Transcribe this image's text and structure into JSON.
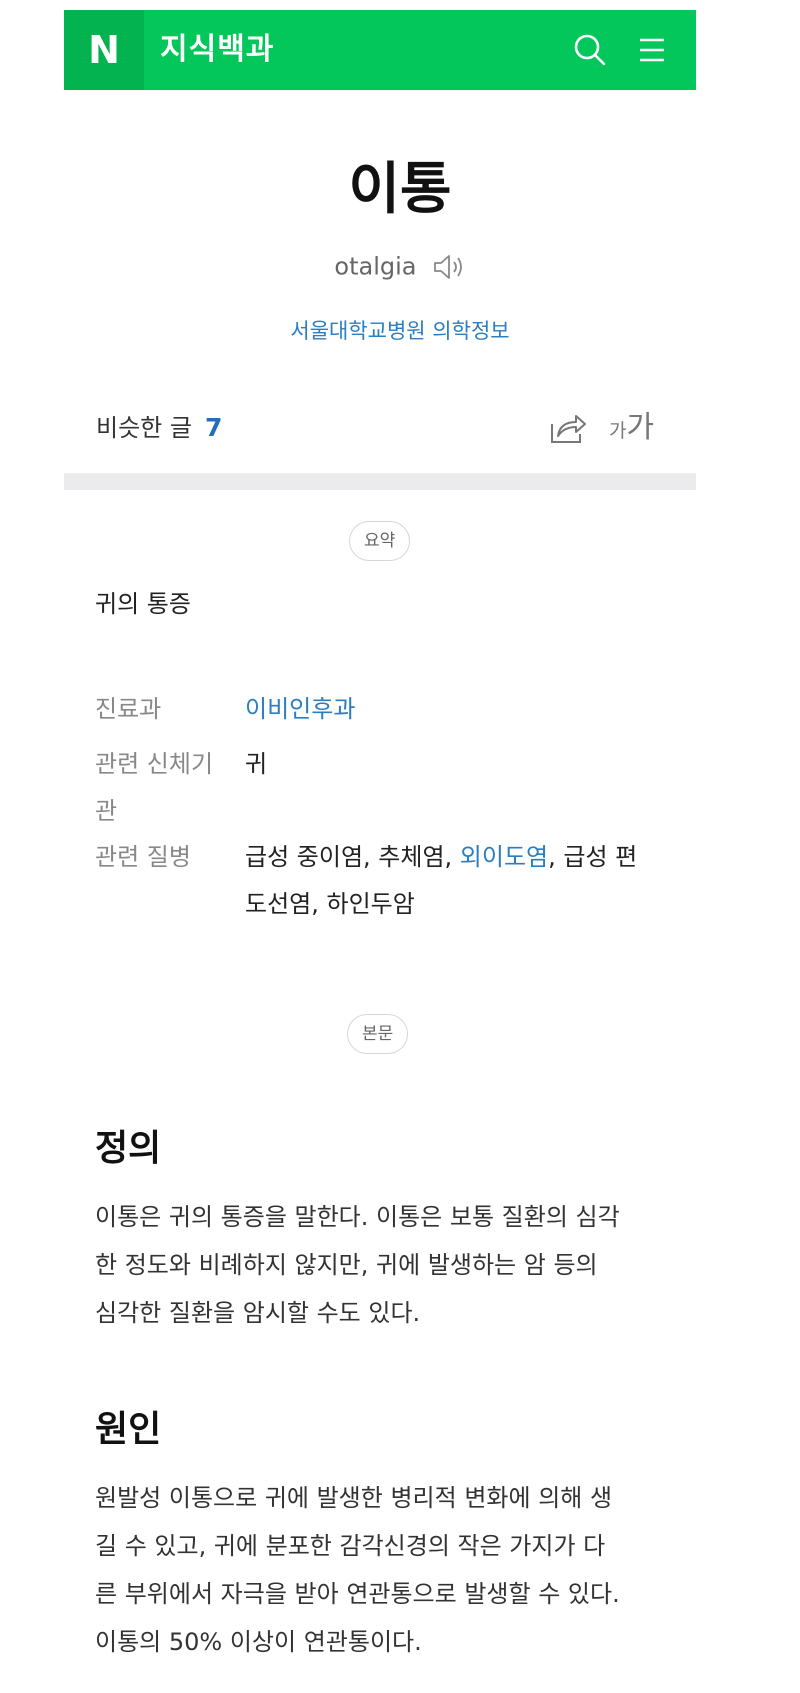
{
  "header": {
    "logo": "N",
    "brand": "지식백과",
    "search_icon": "search-icon",
    "menu_icon": "menu-icon",
    "color": "#03c75a"
  },
  "entry": {
    "title": "이통",
    "subtitle": "otalgia",
    "source": "서울대학교병원 의학정보"
  },
  "toolbar": {
    "similar_label": "비슷한 글",
    "similar_count": "7",
    "font_small": "가",
    "font_big": "가"
  },
  "summary": {
    "pill": "요약",
    "text": "귀의 통증"
  },
  "info": {
    "department_label": "진료과",
    "department_value": "이비인후과",
    "organ_label_1": "관련 신체기",
    "organ_label_2": "관",
    "organ_value": "귀",
    "disease_label": "관련 질병",
    "disease_part1": "급성 중이염, 추체염, ",
    "disease_link": "외이도염",
    "disease_part2": ", 급성 편",
    "disease_line2": "도선염, 하인두암"
  },
  "body": {
    "pill": "본문",
    "sections": [
      {
        "heading": "정의",
        "lines": [
          "이통은 귀의 통증을 말한다. 이통은 보통 질환의 심각",
          "한 정도와 비례하지 않지만, 귀에 발생하는 암 등의",
          "심각한 질환을 암시할 수도 있다."
        ]
      },
      {
        "heading": "원인",
        "lines": [
          "원발성 이통으로 귀에 발생한 병리적 변화에 의해 생",
          "길 수 있고, 귀에 분포한 감각신경의 작은 가지가 다",
          "른 부위에서 자극을 받아 연관통으로 발생할 수 있다.",
          "이통의 50% 이상이 연관통이다."
        ]
      }
    ]
  }
}
